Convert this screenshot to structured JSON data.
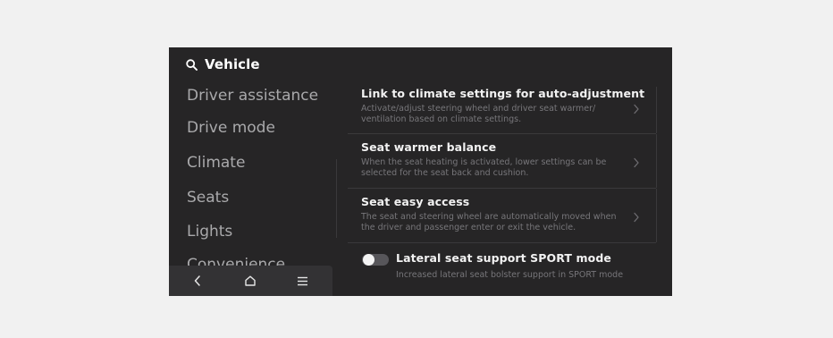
{
  "header": {
    "title": "Vehicle",
    "icon": "search-icon"
  },
  "sidebar": {
    "items": [
      {
        "label": "Driver assistance"
      },
      {
        "label": "Drive mode"
      },
      {
        "label": "Climate"
      },
      {
        "label": "Seats"
      },
      {
        "label": "Lights"
      },
      {
        "label": "Convenience"
      }
    ]
  },
  "nav_bar": {
    "buttons": [
      {
        "icon": "back-icon"
      },
      {
        "icon": "home-icon"
      },
      {
        "icon": "menu-icon"
      }
    ]
  },
  "settings": [
    {
      "title": "Link to climate settings for auto-adjustment",
      "description": "Activate/adjust steering wheel and driver seat warmer/ ventilation based on climate settings.",
      "icon": "chevron-right-icon"
    },
    {
      "title": "Seat warmer balance",
      "description": "When the seat heating is activated, lower settings can be selected for the seat back and cushion.",
      "icon": "chevron-right-icon"
    },
    {
      "title": "Seat easy access",
      "description": "The seat and steering wheel are automatically moved when the driver and passenger enter or exit the vehicle.",
      "icon": "chevron-right-icon"
    },
    {
      "title": "Lateral seat support SPORT mode",
      "description": "Increased lateral seat bolster support in SPORT mode",
      "toggle_on": false
    }
  ],
  "colors": {
    "screen_bg": "#262526",
    "text_primary": "#f2f2f2",
    "text_secondary": "#77767a",
    "sidebar_text": "#a9a9ab",
    "nav_bg": "#333234"
  }
}
